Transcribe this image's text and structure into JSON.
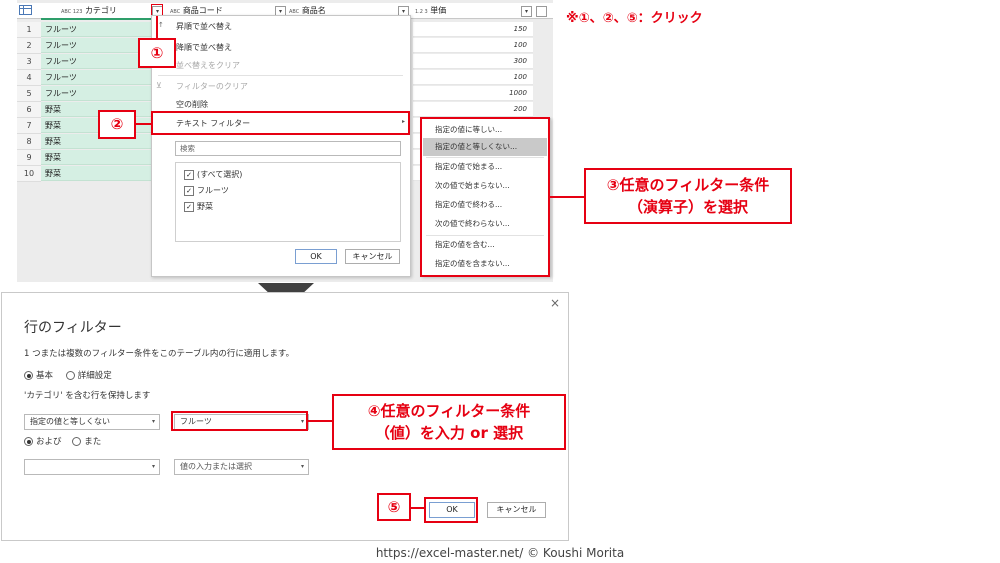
{
  "instruction_note": "※①、②、⑤：クリック",
  "grid": {
    "columns": [
      {
        "type_icon": "ABC 123",
        "name": "カテゴリ"
      },
      {
        "type_icon": "ABC",
        "name": "商品コード"
      },
      {
        "type_icon": "ABC",
        "name": "商品名"
      },
      {
        "type_icon": "1.2 3",
        "name": "単価"
      }
    ],
    "rows": [
      {
        "num": "1",
        "category": "フルーツ",
        "price": "150"
      },
      {
        "num": "2",
        "category": "フルーツ",
        "price": "100"
      },
      {
        "num": "3",
        "category": "フルーツ",
        "price": "300"
      },
      {
        "num": "4",
        "category": "フルーツ",
        "price": "100"
      },
      {
        "num": "5",
        "category": "フルーツ",
        "price": "1000"
      },
      {
        "num": "6",
        "category": "野菜",
        "price": "200"
      },
      {
        "num": "7",
        "category": "野菜",
        "price": ""
      },
      {
        "num": "8",
        "category": "野菜",
        "price": ""
      },
      {
        "num": "9",
        "category": "野菜",
        "price": ""
      },
      {
        "num": "10",
        "category": "野菜",
        "price": ""
      }
    ]
  },
  "menu": {
    "sort_asc": "昇順で並べ替え",
    "sort_desc": "降順で並べ替え",
    "clear_sort": "並べ替えをクリア",
    "clear_filter": "フィルターのクリア",
    "remove_empty": "空の削除",
    "text_filter": "テキスト フィルター",
    "search_placeholder": "検索",
    "checklist": [
      "(すべて選択)",
      "フルーツ",
      "野菜"
    ],
    "ok": "OK",
    "cancel": "キャンセル"
  },
  "submenu": {
    "items": [
      "指定の値に等しい...",
      "指定の値と等しくない...",
      "指定の値で始まる...",
      "次の値で始まらない...",
      "指定の値で終わる...",
      "次の値で終わらない...",
      "指定の値を含む...",
      "指定の値を含まない..."
    ],
    "highlighted_index": 1
  },
  "annotations": {
    "step1": "①",
    "step2": "②",
    "step3_line1": "③任意のフィルター条件",
    "step3_line2": "（演算子）を選択",
    "step4_line1": "④任意のフィルター条件",
    "step4_line2": "（値）を入力 or 選択",
    "step5": "⑤"
  },
  "dialog": {
    "title": "行のフィルター",
    "description": "1 つまたは複数のフィルター条件をこのテーブル内の行に適用します。",
    "mode_basic": "基本",
    "mode_advanced": "詳細設定",
    "keep_rows": "'カテゴリ' を含む行を保持します",
    "operator1": "指定の値と等しくない",
    "value1": "フルーツ",
    "and_label": "および",
    "or_label": "また",
    "operator2": "",
    "value2_placeholder": "値の入力または選択",
    "ok": "OK",
    "cancel": "キャンセル",
    "close": "×"
  },
  "footer": "https://excel-master.net/  © Koushi Morita",
  "colors": {
    "accent_red": "#e60012",
    "green_column": "#d5efe3"
  }
}
